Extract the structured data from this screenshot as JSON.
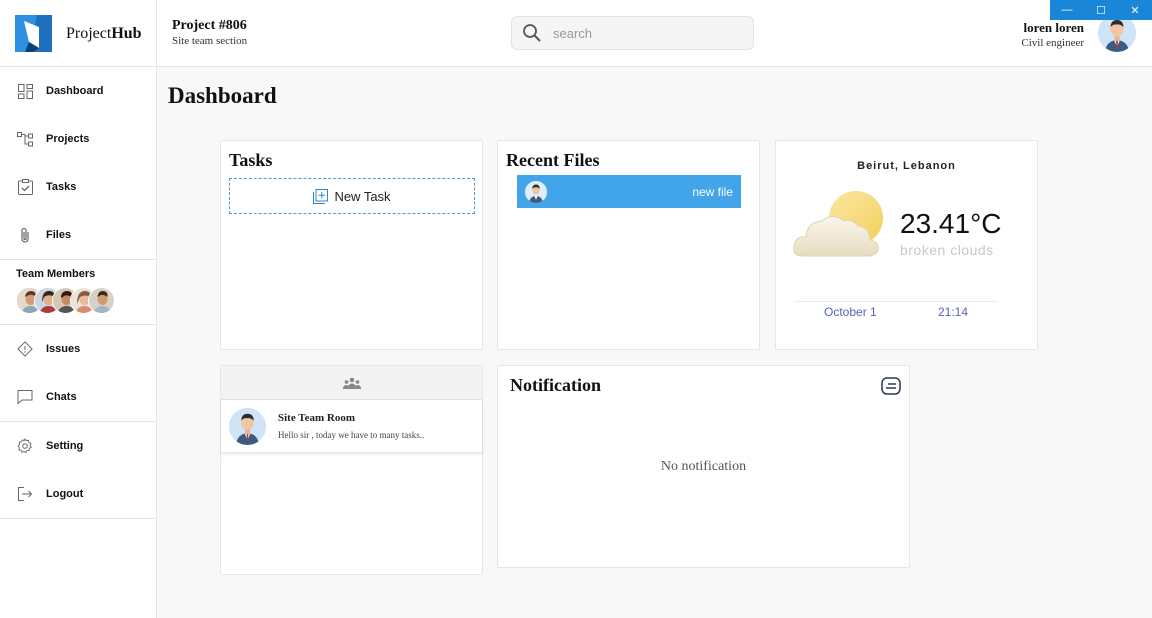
{
  "window": {
    "minimize": "—",
    "maximize": "☐",
    "close": "✕"
  },
  "header": {
    "logo_prefix": "Project",
    "logo_bold": "Hub",
    "project_title": "Project #806",
    "project_subtitle": "Site team section",
    "search_placeholder": "search",
    "user_name": "loren loren",
    "user_role": "Civil engineer"
  },
  "sidebar": {
    "items": [
      {
        "label": "Dashboard",
        "icon": "dashboard-icon"
      },
      {
        "label": "Projects",
        "icon": "projects-icon"
      },
      {
        "label": "Tasks",
        "icon": "tasks-icon"
      },
      {
        "label": "Files",
        "icon": "paperclip-icon"
      }
    ],
    "team_title": "Team Members",
    "items2": [
      {
        "label": "Issues",
        "icon": "diamond-alert-icon"
      },
      {
        "label": "Chats",
        "icon": "chat-bubble-icon"
      }
    ],
    "items3": [
      {
        "label": "Setting",
        "icon": "gear-icon"
      },
      {
        "label": "Logout",
        "icon": "logout-icon"
      }
    ]
  },
  "main": {
    "page_title": "Dashboard",
    "tasks": {
      "title": "Tasks",
      "new_task_label": "New Task"
    },
    "recent_files": {
      "title": "Recent Files",
      "files": [
        {
          "name": "new file"
        }
      ]
    },
    "weather": {
      "city": "Beirut, Lebanon",
      "temperature": "23.41°C",
      "description": "broken clouds",
      "date": "October 1",
      "time": "21:14"
    },
    "chat": {
      "rooms": [
        {
          "name": "Site Team Room",
          "last_message": "Hello sir , today we have to many tasks.."
        }
      ]
    },
    "notification": {
      "title": "Notification",
      "empty_text": "No notification"
    }
  },
  "colors": {
    "accent": "#42a4e9",
    "window_controls": "#1a86d8",
    "date_text": "#5863b8"
  }
}
